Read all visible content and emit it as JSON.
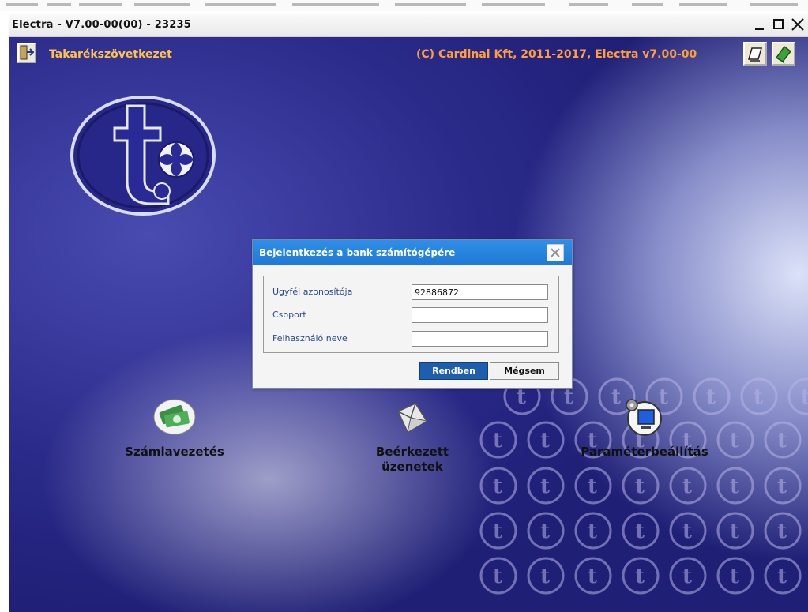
{
  "window": {
    "title": "Electra - V7.00-00(00) - 23235",
    "minimize_icon": "minimize-icon",
    "maximize_icon": "maximize-icon",
    "close_glyph": "✕"
  },
  "header": {
    "app_name": "Takarékszövetkezet",
    "copyright": "(C) Cardinal Kft, 2011-2017, Electra v7.00-00",
    "accent_color": "#ffc24a",
    "copyright_color": "#ff9e3a"
  },
  "actions": [
    {
      "label": "Számlavezetés",
      "icon": "money-icon"
    },
    {
      "label": "Beérkezett üzenetek",
      "icon": "message-icon"
    },
    {
      "label": "Paraméterbeállítás",
      "icon": "settings-icon"
    }
  ],
  "dialog": {
    "title": "Bejelentkezés a bank számítógépére",
    "fields": [
      {
        "label": "Ügyfél azonosítója",
        "value": "92886872"
      },
      {
        "label": "Csoport",
        "value": ""
      },
      {
        "label": "Felhasználó neve",
        "value": ""
      }
    ],
    "ok_label": "Rendben",
    "cancel_label": "Mégsem"
  }
}
